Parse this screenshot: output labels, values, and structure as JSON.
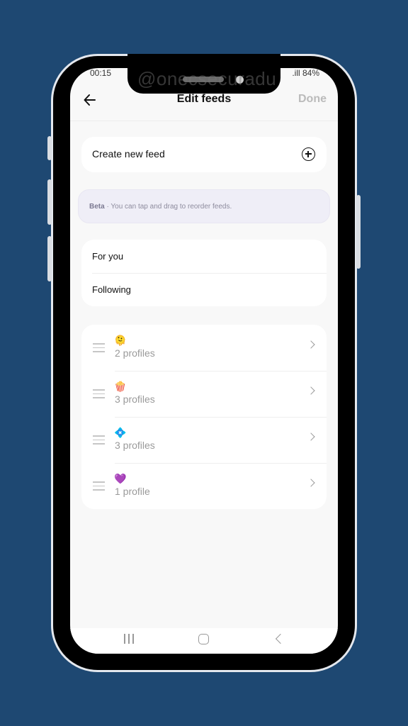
{
  "device": {
    "watermark": "@onecsecuradu"
  },
  "status_bar": {
    "time": "00:15",
    "signal_battery": ".ill 84%"
  },
  "header": {
    "back_icon": "arrow-left-icon",
    "title": "Edit feeds",
    "done_label": "Done"
  },
  "create_feed": {
    "label": "Create new feed",
    "icon": "plus-circle-icon"
  },
  "beta_notice": {
    "label": "Beta",
    "separator": " · ",
    "text": "You can tap and drag to reorder feeds."
  },
  "default_feeds": [
    {
      "label": "For you"
    },
    {
      "label": "Following"
    }
  ],
  "custom_feeds": [
    {
      "emoji": "🫠",
      "count_label": "2 profiles"
    },
    {
      "emoji": "🍿",
      "count_label": "3 profiles"
    },
    {
      "emoji": "💠",
      "count_label": "3 profiles"
    },
    {
      "emoji": "💜",
      "count_label": "1 profile"
    }
  ],
  "nav_bar": {
    "recent_icon": "recent-apps-icon",
    "home_icon": "home-icon",
    "back_icon": "back-icon"
  },
  "colors": {
    "background": "#1e4872",
    "screen": "#f8f8f8",
    "card": "#ffffff",
    "beta_bg": "#efeef7",
    "done_disabled": "#bbbbbb"
  }
}
